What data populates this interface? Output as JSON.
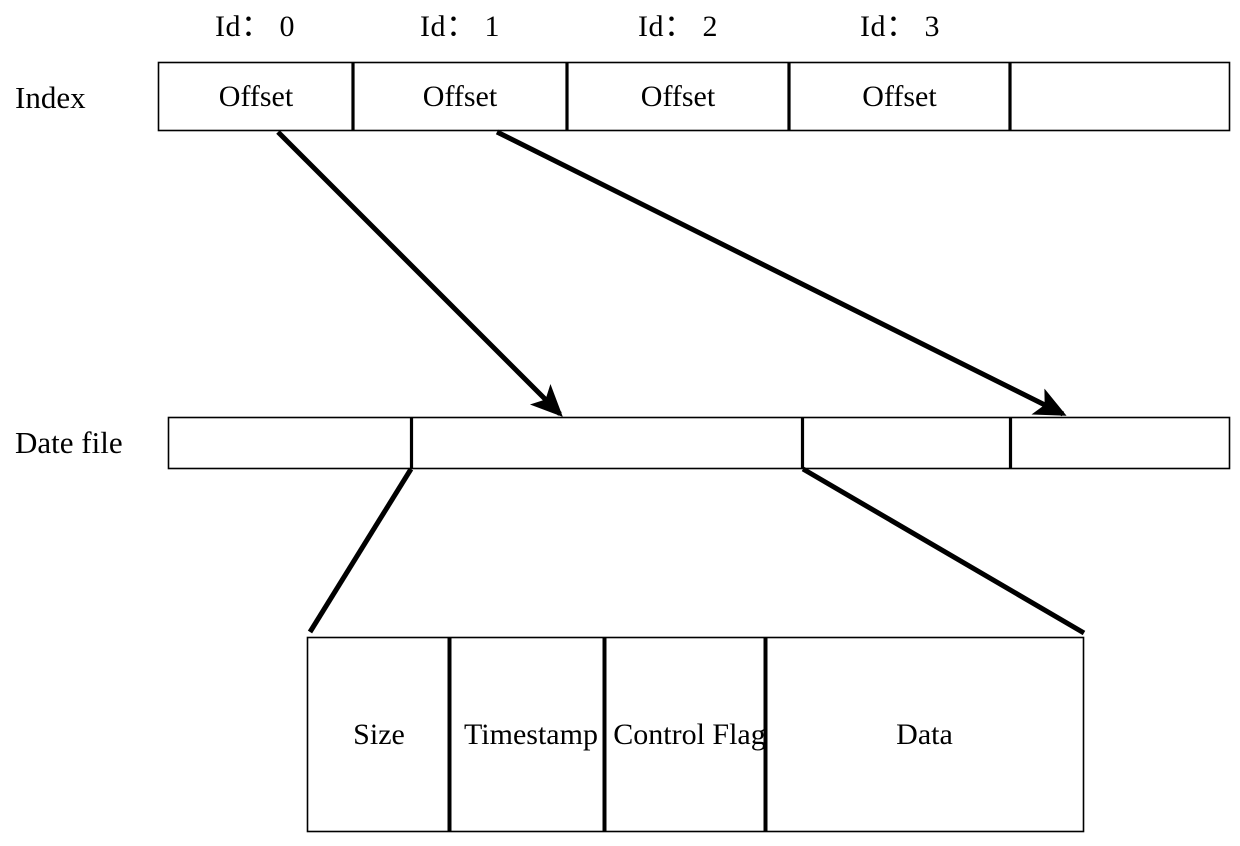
{
  "figure": {
    "type": "diagram",
    "subject": "Index and data file record layout",
    "stroke_color": "#000000",
    "background_color": "#ffffff"
  },
  "index_row": {
    "label": "Index",
    "id_headers": [
      {
        "text": "Id： 0"
      },
      {
        "text": "Id： 1"
      },
      {
        "text": "Id： 2"
      },
      {
        "text": "Id： 3"
      }
    ],
    "cells": [
      {
        "text": "Offset"
      },
      {
        "text": "Offset"
      },
      {
        "text": "Offset"
      },
      {
        "text": "Offset"
      },
      {
        "text": ""
      }
    ]
  },
  "data_row": {
    "label": "Date file",
    "cells": [
      {
        "text": ""
      },
      {
        "text": ""
      },
      {
        "text": ""
      },
      {
        "text": ""
      }
    ]
  },
  "record": {
    "fields": [
      {
        "text": "Size"
      },
      {
        "text": "Timestamp"
      },
      {
        "text": "Control Flag"
      },
      {
        "text": "Data"
      }
    ]
  },
  "connectors": {
    "offset_arrows": [
      {
        "name": "offset-0-arrow",
        "from": "Index cell 0",
        "to": "Data file segment 2 start"
      },
      {
        "name": "offset-1-arrow",
        "from": "Index cell 1",
        "to": "Data file segment 4 start"
      }
    ],
    "expand_lines": [
      {
        "name": "record-expand-left",
        "from": "Data file divider 1",
        "to": "Record box left edge"
      },
      {
        "name": "record-expand-right",
        "from": "Data file divider 2",
        "to": "Record box right edge"
      }
    ]
  }
}
